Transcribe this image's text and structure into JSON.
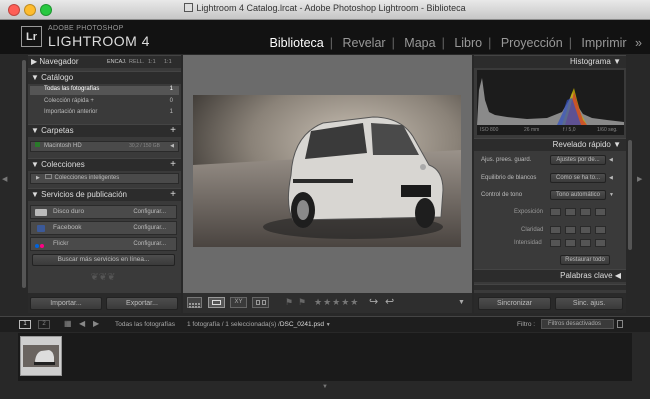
{
  "window": {
    "title": "Lightroom 4 Catalog.lrcat - Adobe Photoshop Lightroom - Biblioteca"
  },
  "identity": {
    "logo": "Lr",
    "adobe": "ADOBE PHOTOSHOP",
    "product": "LIGHTROOM 4"
  },
  "modules": [
    "Biblioteca",
    "Revelar",
    "Mapa",
    "Libro",
    "Proyección",
    "Imprimir"
  ],
  "left": {
    "navigator": {
      "title": "Navegador",
      "options": [
        "ENCAJ.",
        "RELL.",
        "1:1",
        "1:1"
      ]
    },
    "catalog": {
      "title": "Catálogo",
      "items": [
        {
          "label": "Todas las fotografías",
          "count": "1"
        },
        {
          "label": "Colección rápida +",
          "count": "0"
        },
        {
          "label": "Importación anterior",
          "count": "1"
        }
      ]
    },
    "folders": {
      "title": "Carpetas",
      "plus": "+",
      "drive": "Macintosh HD",
      "drive_size": "30,2 / 150 GB"
    },
    "collections": {
      "title": "Colecciones",
      "plus": "+",
      "item": "Colecciones inteligentes"
    },
    "publish": {
      "title": "Servicios de publicación",
      "plus": "+",
      "services": [
        {
          "label": "Disco duro",
          "config": "Configurar..."
        },
        {
          "label": "Facebook",
          "config": "Configurar..."
        },
        {
          "label": "Flickr",
          "config": "Configurar..."
        }
      ],
      "find_more": "Buscar más servicios en línea..."
    },
    "import_btn": "Importar...",
    "export_btn": "Exportar..."
  },
  "right": {
    "histogram": {
      "title": "Histograma",
      "iso": "ISO 800",
      "focal": "26 mm",
      "aperture": "f / 5,0",
      "shutter": "1/60 seg."
    },
    "quick": {
      "title": "Revelado rápido",
      "preset_label": "Ajus. prees. guard.",
      "preset_value": "Ajustes por de...",
      "wb_label": "Equilibrio de blancos",
      "wb_value": "Como se ha to...",
      "tone_label": "Control de tono",
      "auto_tone": "Tono automático",
      "exposure": "Exposición",
      "clarity": "Claridad",
      "vibrance": "Intensidad",
      "reset": "Restaurar todo"
    },
    "keywords": {
      "title": "Palabras clave"
    },
    "sync": "Sincronizar",
    "sync_settings": "Sinc. ajus."
  },
  "filmstrip": {
    "page1": "1",
    "page2": "2",
    "source": "Todas las fotografías",
    "info": "1 fotografía / 1 seleccionada(s) /",
    "file": "DSC_0241.psd",
    "filter_label": "Filtro :",
    "filter_value": "Filtros desactivados"
  },
  "colors": {
    "accent": "#ffffff",
    "panel": "#3a3a3a",
    "bg": "#282828"
  }
}
